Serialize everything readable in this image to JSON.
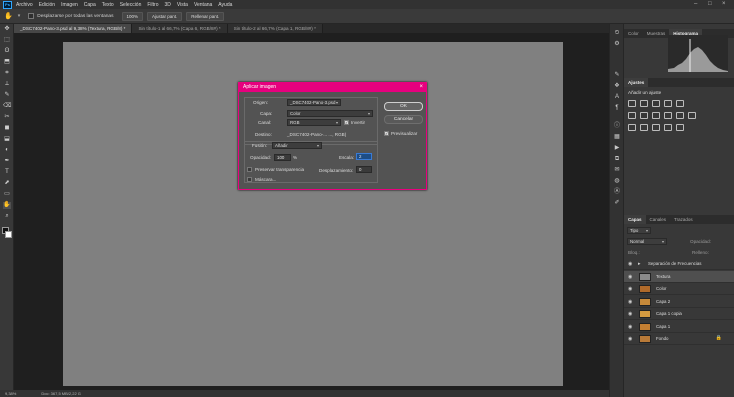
{
  "menu": {
    "items": [
      "Archivo",
      "Edición",
      "Imagen",
      "Capa",
      "Texto",
      "Selección",
      "Filtro",
      "3D",
      "Vista",
      "Ventana",
      "Ayuda"
    ],
    "logo": "Ps",
    "win_controls": [
      "–",
      "□",
      "×"
    ]
  },
  "options": {
    "scroll_all_label": "Desplazarse por todas las ventanas",
    "zoom_value": "100%",
    "fit_screen": "Ajustar pant.",
    "fill_screen": "Rellenar pant."
  },
  "tabs": [
    {
      "label": "_DSC7402-Pano-3.psd al 9,38% (Textura, RGB/8) *",
      "active": true
    },
    {
      "label": "Sin título-1 al 66,7% (Capa 6, RGB/8#) *",
      "active": false
    },
    {
      "label": "Sin título-2 al 66,7% (Capa 1, RGB/8#) *",
      "active": false
    }
  ],
  "tools": [
    "✥",
    "⬚",
    "ʘ",
    "⬒",
    "⌗",
    "⟂",
    "✎",
    "⌫",
    "✂",
    "◼",
    "⬓",
    "◐",
    "✒",
    "T",
    "⬈",
    "▭",
    "✋",
    "⌕"
  ],
  "status": {
    "zoom": "9,38%",
    "doc": "Doc: 367,5 MB/2,22 G"
  },
  "dialog": {
    "title": "Aplicar imagen",
    "close": "×",
    "origen_label": "Origen:",
    "origen_value": "_DSC7402-Pano-3.psd",
    "capa_label": "Capa:",
    "capa_value": "Color",
    "canal_label": "Canal:",
    "canal_value": "RGB",
    "invertir_label": "Invertir",
    "invertir_checked": true,
    "destino_label": "Destino:",
    "destino_value": "_DSC7402-Pano-... ..., RGB)",
    "fusion_label": "Fusión:",
    "fusion_value": "Añadir",
    "opacidad_label": "Opacidad:",
    "opacidad_value": "100",
    "opacidad_unit": "%",
    "escala_label": "Escala:",
    "escala_value": "2",
    "desplazamiento_label": "Desplazamiento:",
    "desplazamiento_value": "0",
    "preservar_label": "Preservar transparencia",
    "mascara_label": "Máscara...",
    "ok_label": "OK",
    "cancel_label": "Cancelar",
    "preview_label": "Previsualizar",
    "preview_checked": true,
    "accent": "#e6007e"
  },
  "panels": {
    "top_tabs": [
      "Color",
      "Muestras",
      "Histograma"
    ],
    "adj_tabs": [
      "Ajustes"
    ],
    "adj_hint": "Añadir un ajuste",
    "layer_tabs": [
      "Capas",
      "Canales",
      "Trazados"
    ],
    "layer_kind": "Tipo",
    "blend_mode": "Normal",
    "opacity_label": "Opacidad:",
    "fill_label": "Relleno:",
    "lock_label": "Bloq.:",
    "layers": [
      {
        "name": "Separación de Frecuencias",
        "group": true,
        "selected": false
      },
      {
        "name": "Textura",
        "group": false,
        "selected": true,
        "thumb": "#8a8a8a"
      },
      {
        "name": "Color",
        "group": false,
        "selected": false,
        "thumb": "#b06a2a"
      },
      {
        "name": "Capa 2",
        "group": false,
        "selected": false,
        "thumb": "#c78a3a"
      },
      {
        "name": "Capa 1 copia",
        "group": false,
        "selected": false,
        "thumb": "#d49a40"
      },
      {
        "name": "Capa 1",
        "group": false,
        "selected": false,
        "thumb": "#c47f32"
      },
      {
        "name": "Fondo",
        "group": false,
        "selected": false,
        "thumb": "#b97a38",
        "locked": true
      }
    ]
  }
}
